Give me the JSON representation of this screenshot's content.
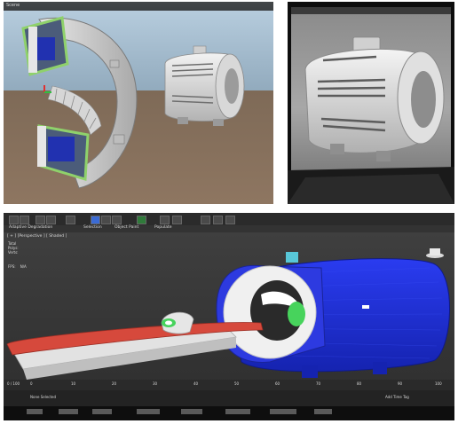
{
  "top_left_photo": {
    "scene_label": "Scene",
    "viewer_window": "Unity scene viewport with MRI scanner cutaway model and enclosed scanner model"
  },
  "top_right_photo": {
    "viewer_window": "Close-up of enclosed scanner model on monitor"
  },
  "bottom_photo": {
    "menu_items": [
      "Adaptive Degradation",
      "Selection",
      "Object Paint",
      "Populate"
    ],
    "viewport_label": "[ + ] [Perspective ] [ Shaded ]",
    "stats": {
      "total_label": "Total",
      "polys_label": "Polys:",
      "verts_label": "Verts:",
      "fps_label": "FPS:",
      "fps_value": "N/A"
    },
    "timeline_ticks": [
      "0",
      "10",
      "20",
      "30",
      "40",
      "50",
      "60",
      "70",
      "80",
      "90",
      "100"
    ],
    "status_left": "None Selected",
    "status_right": "Add Time Tag",
    "time_readout": "0 / 100"
  },
  "colors": {
    "unity_sky": "#9db8cf",
    "unity_floor": "#85705c",
    "max_viewport": "#3a3a3a",
    "scanner_blue": "#1e2fd8",
    "table_red": "#d6493c",
    "bore_green": "#47d35c",
    "cap_cyan": "#58c7d8"
  }
}
